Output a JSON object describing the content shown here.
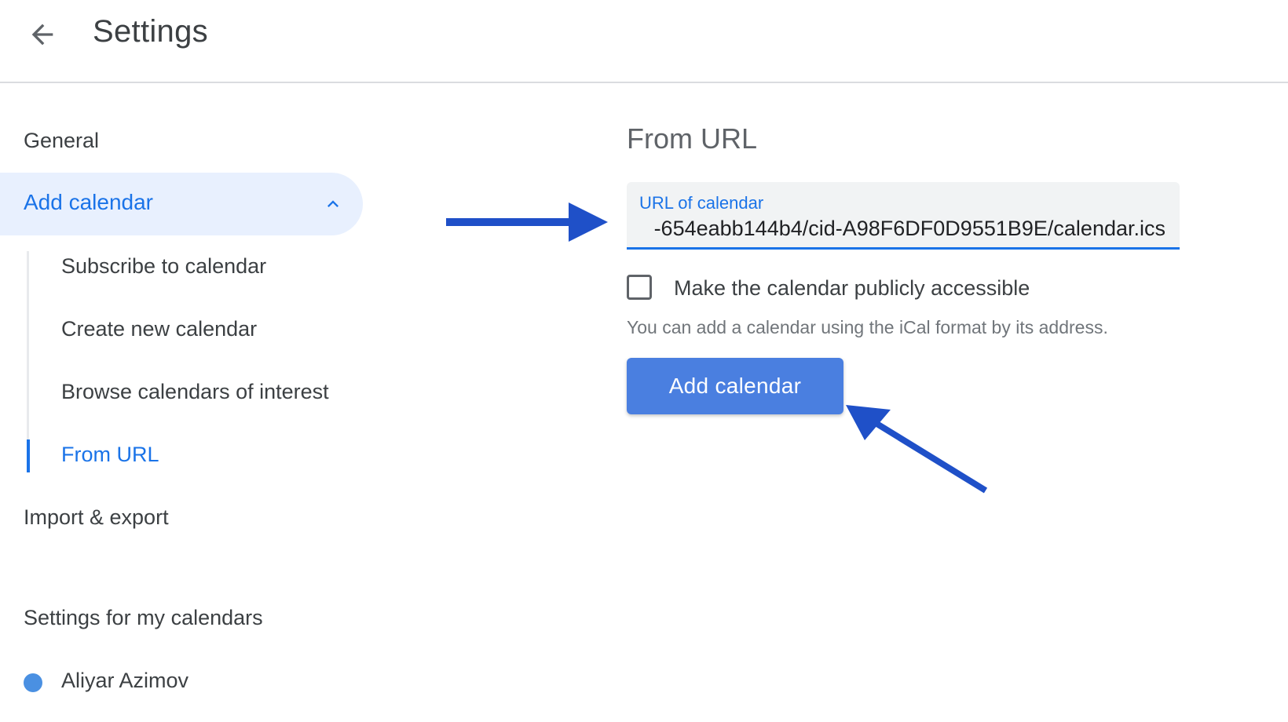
{
  "header": {
    "title": "Settings",
    "back_icon": "arrow-back-icon"
  },
  "sidebar": {
    "general": "General",
    "add_calendar": {
      "label": "Add calendar",
      "expanded": true,
      "icon": "chevron-up-icon",
      "items": [
        {
          "label": "Subscribe to calendar",
          "active": false
        },
        {
          "label": "Create new calendar",
          "active": false
        },
        {
          "label": "Browse calendars of interest",
          "active": false
        },
        {
          "label": "From URL",
          "active": true
        }
      ]
    },
    "import_export": "Import & export",
    "my_calendars": {
      "title": "Settings for my calendars",
      "items": [
        {
          "name": "Aliyar Azimov",
          "color": "#4a90e2"
        }
      ]
    }
  },
  "main": {
    "title": "From URL",
    "url_field": {
      "label": "URL of calendar",
      "value": "-654eabb144b4/cid-A98F6DF0D9551B9E/calendar.ics"
    },
    "public_checkbox": {
      "label": "Make the calendar publicly accessible",
      "checked": false
    },
    "helper_text": "You can add a calendar using the iCal format by its address.",
    "submit_label": "Add calendar"
  },
  "colors": {
    "accent": "#1a73e8",
    "active_nav_bg": "#e8f0fe",
    "button_bg": "#4a7fe0",
    "annotation_arrow": "#1f50c8"
  }
}
